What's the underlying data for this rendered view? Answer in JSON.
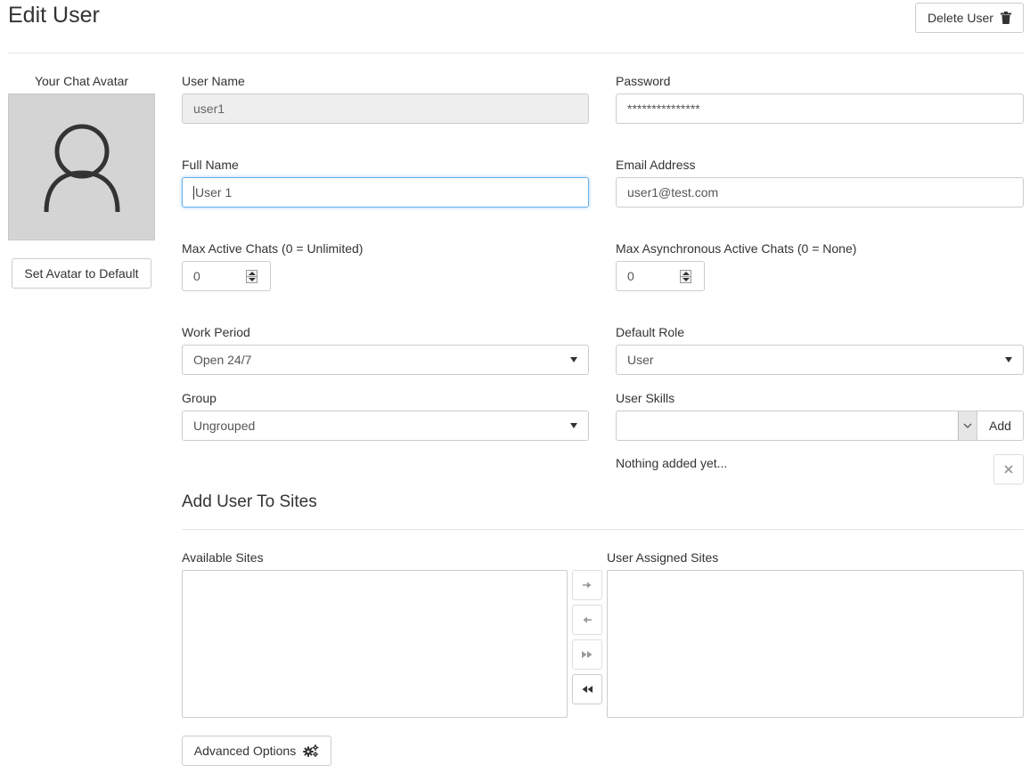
{
  "page": {
    "title": "Edit User"
  },
  "header": {
    "delete_label": "Delete User"
  },
  "avatar": {
    "label": "Your Chat Avatar",
    "reset_label": "Set Avatar to Default"
  },
  "form": {
    "username": {
      "label": "User Name",
      "value": "user1"
    },
    "password": {
      "label": "Password",
      "value": "***************"
    },
    "fullname": {
      "label": "Full Name",
      "value": "User 1"
    },
    "email": {
      "label": "Email Address",
      "value": "user1@test.com"
    },
    "max_chats": {
      "label": "Max Active Chats (0 = Unlimited)",
      "value": "0"
    },
    "max_async": {
      "label": "Max Asynchronous Active Chats (0 = None)",
      "value": "0"
    },
    "work_period": {
      "label": "Work Period",
      "value": "Open 24/7"
    },
    "default_role": {
      "label": "Default Role",
      "value": "User"
    },
    "group": {
      "label": "Group",
      "value": "Ungrouped"
    },
    "skills": {
      "label": "User Skills",
      "value": "",
      "add_label": "Add",
      "empty_text": "Nothing added yet..."
    }
  },
  "sites": {
    "title": "Add User To Sites",
    "available_label": "Available Sites",
    "assigned_label": "User Assigned Sites",
    "available": [],
    "assigned": []
  },
  "advanced": {
    "label": "Advanced Options"
  }
}
